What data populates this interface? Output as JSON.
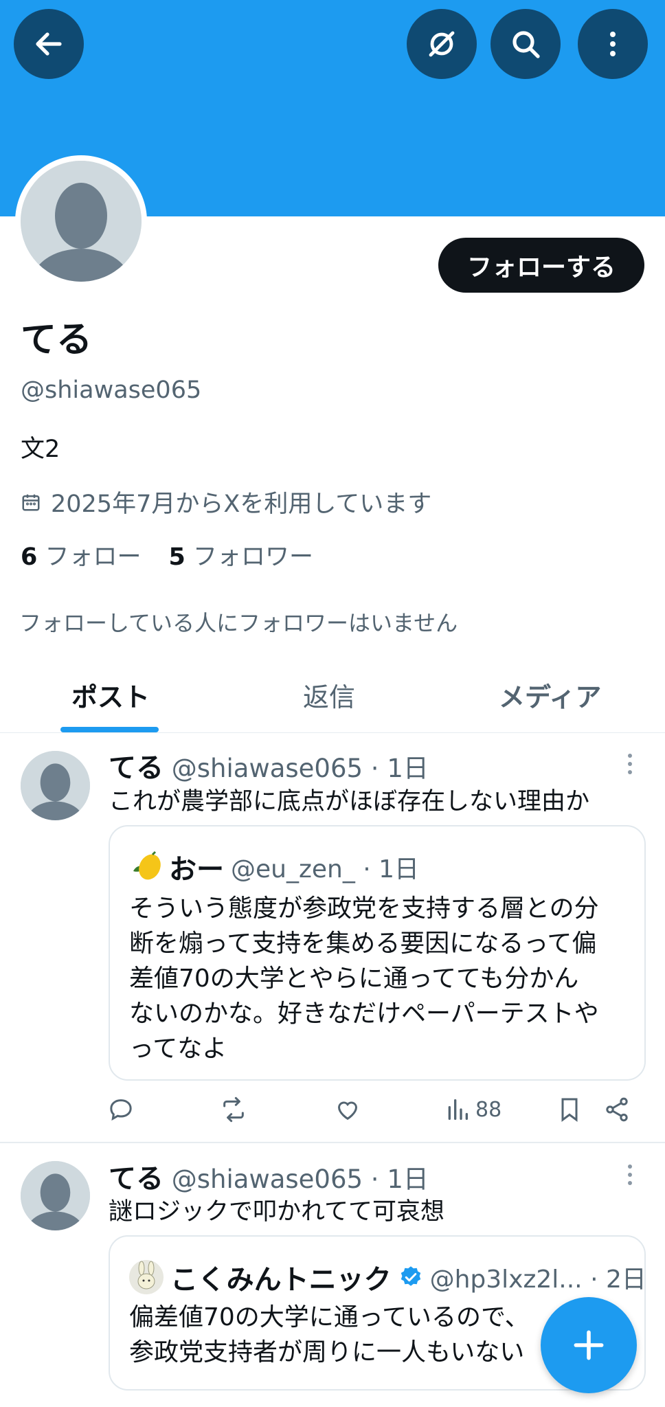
{
  "header": {
    "back_icon": "back-arrow-icon",
    "grok_icon": "grok-icon",
    "search_icon": "search-icon",
    "more_icon": "more-vertical-icon",
    "banner_color": "#1d9bf0"
  },
  "profile": {
    "follow_label": "フォローする",
    "name": "てる",
    "handle": "@shiawase065",
    "bio": "文2",
    "joined": "2025年7月からXを利用しています",
    "following_count": "6",
    "following_label": "フォロー",
    "followers_count": "5",
    "followers_label": "フォロワー",
    "mutual_note": "フォローしている人にフォロワーはいません"
  },
  "tabs": [
    {
      "label": "ポスト",
      "active": true
    },
    {
      "label": "返信",
      "active": false
    },
    {
      "label": "メディア",
      "active": false
    }
  ],
  "posts": [
    {
      "name": "てる",
      "meta": "@shiawase065 · 1日",
      "text": "これが農学部に底点がほぼ存在しない理由か",
      "quote": {
        "name": "おー",
        "meta": "@eu_zen_ · 1日",
        "lines": [
          "そういう態度が参政党を支持する層との分",
          "断を煽って支持を集める要因になるって偏",
          "差値70の大学とやらに通ってても分かん",
          "ないのかな。好きなだけペーパーテストや",
          "ってなよ"
        ]
      },
      "views": "88"
    },
    {
      "name": "てる",
      "meta": "@shiawase065 · 1日",
      "text": "謎ロジックで叩かれてて可哀想",
      "quote": {
        "name": "こくみんトニック",
        "meta": "@hp3lxz2l... · 2日",
        "lines": [
          "偏差値70の大学に通っているので、",
          "参政党支持者が周りに一人もいない"
        ]
      }
    }
  ],
  "fab_icon": "plus-icon"
}
